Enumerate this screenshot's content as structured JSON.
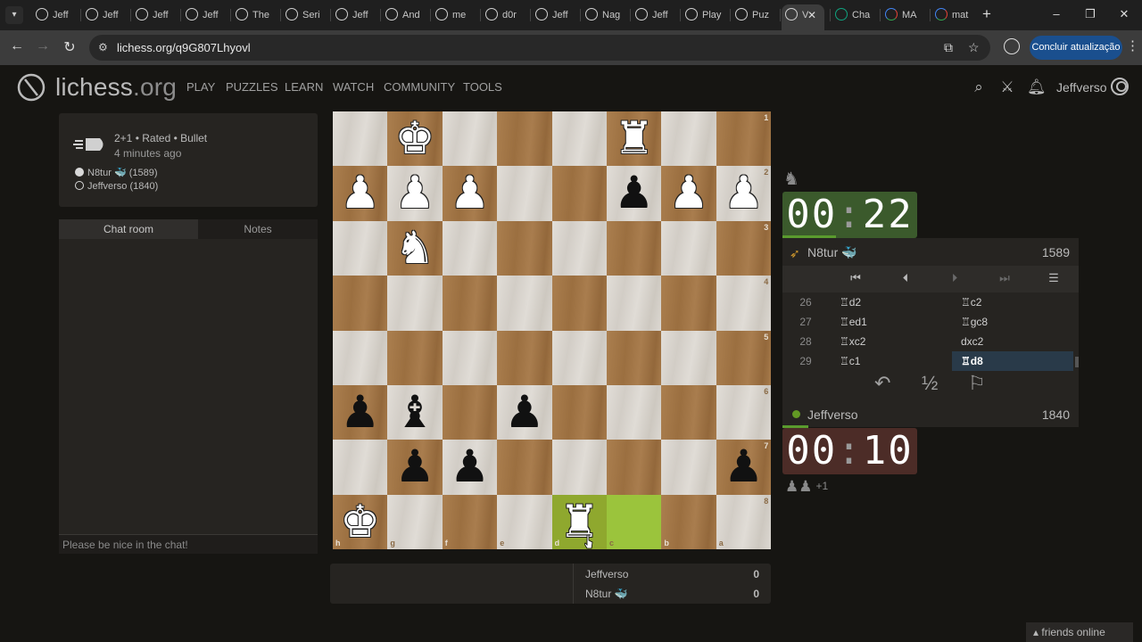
{
  "browser": {
    "tabs": [
      {
        "label": "Jeff",
        "icon": "lichess"
      },
      {
        "label": "Jeff",
        "icon": "lichess"
      },
      {
        "label": "Jeff",
        "icon": "lichess"
      },
      {
        "label": "Jeff",
        "icon": "lichess"
      },
      {
        "label": "The",
        "icon": "lichess"
      },
      {
        "label": "Seri",
        "icon": "lichess"
      },
      {
        "label": "Jeff",
        "icon": "lichess"
      },
      {
        "label": "And",
        "icon": "lichess"
      },
      {
        "label": "me",
        "icon": "lichess"
      },
      {
        "label": "d0r",
        "icon": "lichess"
      },
      {
        "label": "Jeff",
        "icon": "lichess"
      },
      {
        "label": "Nag",
        "icon": "lichess"
      },
      {
        "label": "Jeff",
        "icon": "lichess"
      },
      {
        "label": "Play",
        "icon": "lichess"
      },
      {
        "label": "Puz",
        "icon": "lichess"
      },
      {
        "label": "V",
        "icon": "lichess",
        "active": true
      },
      {
        "label": "Cha",
        "icon": "chatgpt"
      },
      {
        "label": "MA",
        "icon": "google"
      },
      {
        "label": "mat",
        "icon": "google"
      }
    ],
    "url": "lichess.org/q9G807Lhyovl",
    "update_label": "Concluir atualização"
  },
  "header": {
    "logo": "lichess",
    "logo_tld": ".org",
    "nav": [
      "PLAY",
      "PUZZLES",
      "LEARN",
      "WATCH",
      "COMMUNITY",
      "TOOLS"
    ],
    "username": "Jeffverso"
  },
  "game": {
    "meta": "2+1 • Rated • Bullet",
    "time_ago": "4 minutes ago",
    "white_player": "N8tur 🐳 (1589)",
    "black_player": "Jeffverso (1840)"
  },
  "chat": {
    "tab_chat": "Chat room",
    "tab_notes": "Notes",
    "placeholder": "Please be nice in the chat!"
  },
  "board": {
    "rank_labels": [
      "1",
      "2",
      "3",
      "4",
      "5",
      "6",
      "7",
      "8"
    ],
    "file_labels": [
      "h",
      "g",
      "f",
      "e",
      "d",
      "c",
      "b",
      "a"
    ],
    "pieces": [
      {
        "row": 0,
        "col": 1,
        "glyph": "♚",
        "color": "w"
      },
      {
        "row": 0,
        "col": 5,
        "glyph": "♜",
        "color": "w"
      },
      {
        "row": 1,
        "col": 0,
        "glyph": "♟",
        "color": "w"
      },
      {
        "row": 1,
        "col": 1,
        "glyph": "♟",
        "color": "w"
      },
      {
        "row": 1,
        "col": 2,
        "glyph": "♟",
        "color": "w"
      },
      {
        "row": 1,
        "col": 5,
        "glyph": "♟",
        "color": "b"
      },
      {
        "row": 1,
        "col": 6,
        "glyph": "♟",
        "color": "w"
      },
      {
        "row": 1,
        "col": 7,
        "glyph": "♟",
        "color": "w"
      },
      {
        "row": 2,
        "col": 1,
        "glyph": "♞",
        "color": "w"
      },
      {
        "row": 5,
        "col": 0,
        "glyph": "♟",
        "color": "b"
      },
      {
        "row": 5,
        "col": 1,
        "glyph": "♝",
        "color": "b"
      },
      {
        "row": 5,
        "col": 3,
        "glyph": "♟",
        "color": "b"
      },
      {
        "row": 6,
        "col": 1,
        "glyph": "♟",
        "color": "b"
      },
      {
        "row": 6,
        "col": 2,
        "glyph": "♟",
        "color": "b"
      },
      {
        "row": 6,
        "col": 7,
        "glyph": "♟",
        "color": "b"
      },
      {
        "row": 7,
        "col": 0,
        "glyph": "♚",
        "color": "w"
      },
      {
        "row": 7,
        "col": 4,
        "glyph": "♜",
        "color": "w"
      }
    ],
    "highlights": [
      {
        "row": 7,
        "col": 4,
        "kind": "hl2"
      },
      {
        "row": 7,
        "col": 5,
        "kind": "hl"
      }
    ]
  },
  "clocks": {
    "top_min": "00",
    "top_sec": "22",
    "bottom_min": "00",
    "bottom_sec": "10",
    "top_remaining_fraction": 0.4,
    "bottom_remaining_fraction": 0.19
  },
  "players": {
    "top_name": "N8tur 🐳",
    "top_rating": "1589",
    "bottom_name": "Jeffverso",
    "bottom_rating": "1840"
  },
  "moves": [
    {
      "num": "26",
      "white": "♖d2",
      "black": "♖c2"
    },
    {
      "num": "27",
      "white": "♖ed1",
      "black": "♖gc8"
    },
    {
      "num": "28",
      "white": "♖xc2",
      "black": "dxc2"
    },
    {
      "num": "29",
      "white": "♖c1",
      "black": "♖d8",
      "active": true
    }
  ],
  "actions": {
    "draw": "½"
  },
  "material": {
    "glyphs": "♟♟",
    "plus": "+1"
  },
  "crosstable": [
    {
      "name": "Jeffverso",
      "score": "0"
    },
    {
      "name": "N8tur 🐳",
      "score": "0"
    }
  ],
  "friends": "▴ friends online",
  "colors": {
    "accent": "#629924",
    "clock_active": "#3b5a2c",
    "clock_low": "#4c2c27",
    "move_highlight": "#293a49"
  }
}
